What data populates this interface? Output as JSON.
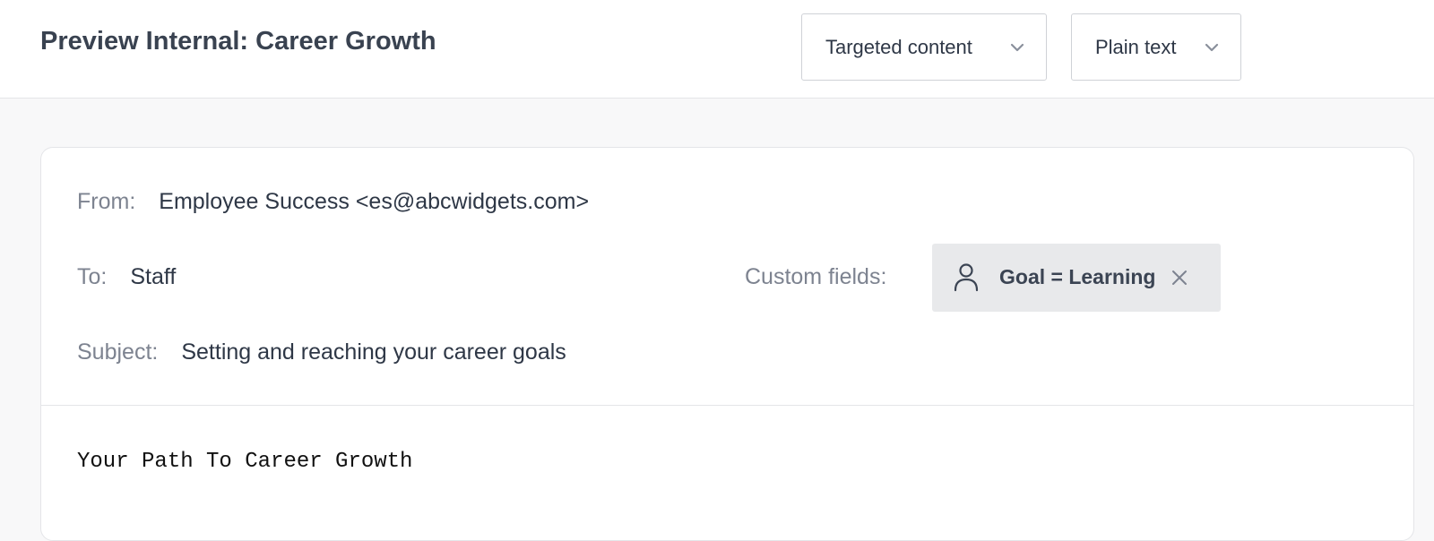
{
  "header": {
    "title": "Preview Internal: Career Growth",
    "content_dropdown": {
      "selected": "Targeted content",
      "icon": "chevron-down-icon"
    },
    "format_dropdown": {
      "selected": "Plain text",
      "icon": "chevron-down-icon"
    }
  },
  "email": {
    "from_label": "From:",
    "from_value": "Employee Success <es@abcwidgets.com>",
    "to_label": "To:",
    "to_value": "Staff",
    "subject_label": "Subject:",
    "subject_value": "Setting and reaching your career goals",
    "custom_fields_label": "Custom fields:",
    "custom_field_chip": {
      "text": "Goal = Learning",
      "icon": "person-icon",
      "remove_icon": "close-icon"
    },
    "body_heading": "Your Path To Career Growth"
  },
  "colors": {
    "text_primary": "#2e3746",
    "text_muted": "#7d8390",
    "chip_bg": "#e8e9eb",
    "border": "#e4e5e8"
  }
}
